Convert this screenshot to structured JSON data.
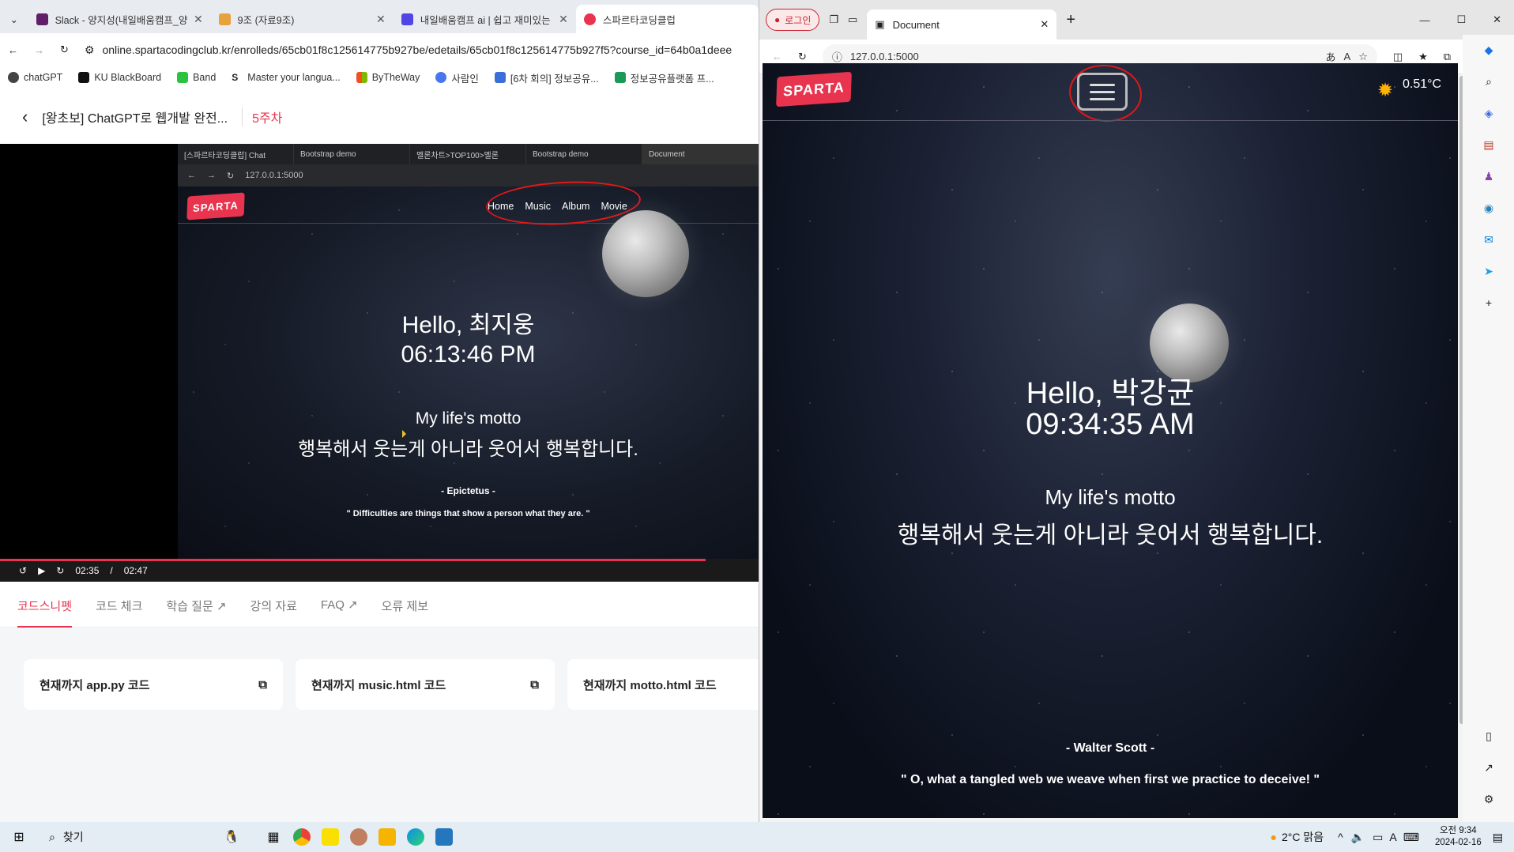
{
  "left_browser": {
    "tabs": [
      {
        "title": "Slack - 양지성(내일배움캠프_양",
        "color": "#611f69"
      },
      {
        "title": "9조 (자료9조)",
        "color": "#e8a23b"
      },
      {
        "title": "내일배움캠프 ai | 쉽고 재미있는",
        "color": "#4f46e5"
      },
      {
        "title": "스파르타코딩클럽",
        "color": "#e8344e"
      }
    ],
    "url": "online.spartacodingclub.kr/enrolleds/65cb01f8c125614775b927be/edetails/65cb01f8c125614775b927f5?course_id=64b0a1deee",
    "bookmarks": [
      {
        "label": "chatGPT",
        "color": "#444"
      },
      {
        "label": "KU BlackBoard",
        "color": "#111"
      },
      {
        "label": "Band",
        "color": "#2cc23e"
      },
      {
        "label": "Master your langua...",
        "color": "#222"
      },
      {
        "label": "ByTheWay",
        "color": "#f25022"
      },
      {
        "label": "사람인",
        "color": "#4876ef"
      },
      {
        "label": "[6차 회의] 정보공유...",
        "color": "#3b6fd8"
      },
      {
        "label": "정보공유플랫폼 프...",
        "color": "#1a9a54"
      }
    ],
    "course_title": "[왕초보] ChatGPT로 웹개발 완전...",
    "week": "5주차",
    "video": {
      "inner_tabs": [
        "[스파르타코딩클럽] Chat",
        "Bootstrap demo",
        "멜론차트>TOP100>멜론",
        "Bootstrap demo",
        "Document"
      ],
      "inner_url": "127.0.0.1:5000",
      "logo": "SPARTA",
      "nav": [
        "Home",
        "Music",
        "Album",
        "Movie"
      ],
      "greeting": "Hello, 최지웅",
      "time": "06:13:46 PM",
      "motto_title": "My life's motto",
      "motto": "행복해서 웃는게 아니라 웃어서 행복합니다.",
      "author": "- Epictetus -",
      "quote": "\" Difficulties are things that show a person what they are. \"",
      "current_time": "02:35",
      "separator": "/",
      "duration": "02:47",
      "progress": 0.93
    },
    "lower_tabs": [
      "코드스니펫",
      "코드 체크",
      "학습 질문",
      "강의 자료",
      "FAQ",
      "오류 제보"
    ],
    "cards": [
      "현재까지 app.py 코드",
      "현재까지 music.html 코드",
      "현재까지 motto.html 코드"
    ]
  },
  "right_browser": {
    "profile": "로그인",
    "tab_title": "Document",
    "url": "127.0.0.1:5000",
    "logo": "SPARTA",
    "temperature": "0.51°C",
    "greeting": "Hello, 박강균",
    "time": "09:34:35 AM",
    "motto_title": "My life's motto",
    "motto": "행복해서 웃는게 아니라 웃어서 행복합니다.",
    "author": "- Walter Scott -",
    "quote": "\" O, what a tangled web we weave when first we practice to deceive! \""
  },
  "taskbar": {
    "search": "찾기",
    "weather": "2°C 맑음",
    "clock_time": "오전 9:34",
    "clock_date": "2024-02-16",
    "input_mode": "A"
  },
  "colors": {
    "accent": "#e8344e",
    "annotation": "#e01818"
  }
}
